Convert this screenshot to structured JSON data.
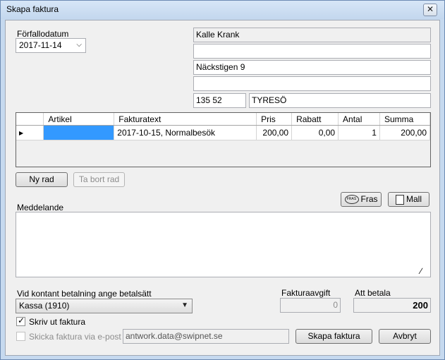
{
  "window": {
    "title": "Skapa faktura",
    "close_glyph": "✕"
  },
  "due_date": {
    "label": "Förfallodatum",
    "value": "2017-11-14"
  },
  "address": {
    "name": "Kalle Krank",
    "line2": "",
    "street": "Näckstigen 9",
    "line4": "",
    "postcode": "135 52",
    "city": "TYRESÖ"
  },
  "grid": {
    "columns": [
      "Artikel",
      "Fakturatext",
      "Pris",
      "Rabatt",
      "Antal",
      "Summa"
    ],
    "rows": [
      {
        "artikel": "",
        "text": "2017-10-15, Normalbesök",
        "pris": "200,00",
        "rabatt": "0,00",
        "antal": "1",
        "summa": "200,00"
      }
    ]
  },
  "buttons": {
    "new_row": "Ny rad",
    "delete_row": "Ta bort rad",
    "fras": "Fras",
    "mall": "Mall",
    "create": "Skapa faktura",
    "cancel": "Avbryt"
  },
  "message": {
    "label": "Meddelande",
    "value": ""
  },
  "payment": {
    "label": "Vid kontant betalning ange betalsätt",
    "selected": "Kassa (1910)"
  },
  "fee": {
    "label": "Fakturaavgift",
    "value": "0"
  },
  "to_pay": {
    "label": "Att betala",
    "value": "200"
  },
  "print_invoice": {
    "label": "Skriv ut faktura",
    "checked": true
  },
  "email_invoice": {
    "label": "Skicka faktura via e-post",
    "checked": false,
    "address": "antwork.data@swipnet.se"
  },
  "colors": {
    "selection": "#3399ff",
    "window_border": "#6d8bb3"
  }
}
